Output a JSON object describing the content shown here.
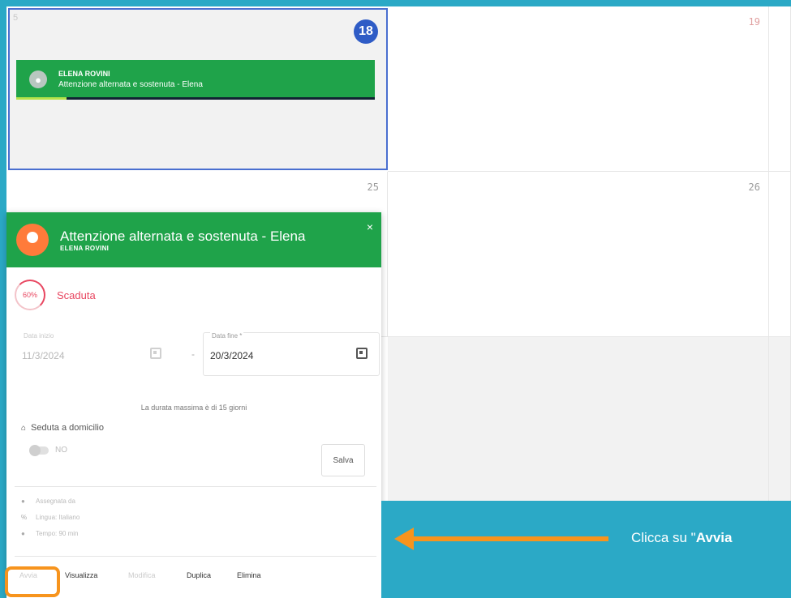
{
  "calendar": {
    "cells": [
      {
        "num": "18",
        "today": true
      },
      {
        "num": "19"
      },
      {
        "num": "25"
      },
      {
        "num": "26"
      }
    ],
    "corner_mark": "5"
  },
  "event": {
    "assignee": "ELENA ROVINI",
    "title": "Attenzione alternata e sostenuta - Elena"
  },
  "card": {
    "title": "Attenzione alternata e sostenuta - Elena",
    "subtitle": "ELENA ROVINI",
    "close_icon": "×",
    "progress_label": "60%",
    "progress_value": 0.6,
    "status": "Scaduta",
    "start_label": "Data inizio",
    "start_value": "11/3/2024",
    "end_label": "Data fine *",
    "end_value": "20/3/2024",
    "dash": "-",
    "hint": "La durata massima è di 15 giorni",
    "home_label": "Seduta a domicilio",
    "toggle_label": "NO",
    "save_label": "Salva",
    "info": {
      "assigned": "Assegnata da",
      "language": "Lingua: Italiano",
      "time": "Tempo: 90 min"
    },
    "actions": {
      "avvia": "Avvia",
      "visualizza": "Visualizza",
      "modifica": "Modifica",
      "duplica": "Duplica",
      "elimina": "Elimina"
    }
  },
  "banner": {
    "prefix": "Clicca su \"",
    "bold": "Avvia"
  },
  "colors": {
    "accent_blue": "#2ba9c6",
    "event_green": "#1fa34a",
    "highlight_orange": "#f7941d",
    "status_red": "#e84660"
  }
}
